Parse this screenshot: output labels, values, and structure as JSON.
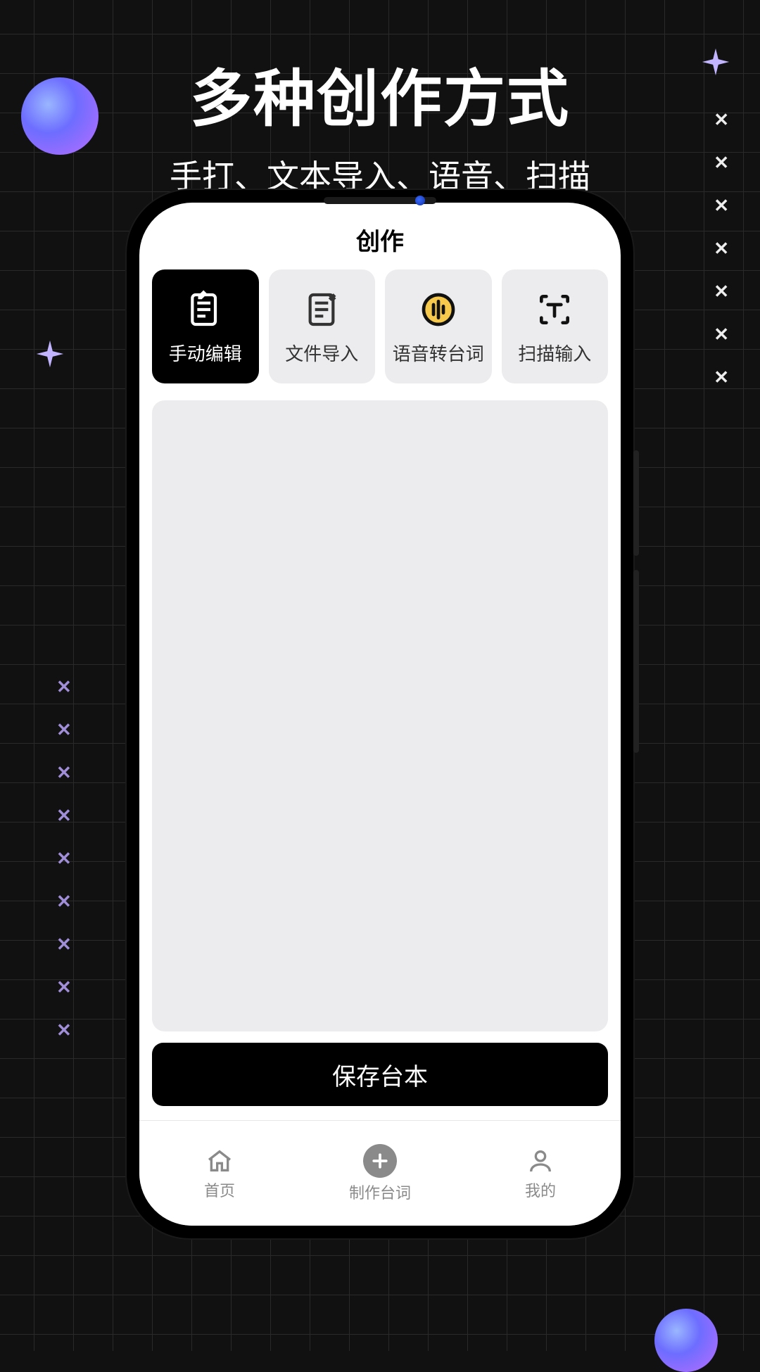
{
  "hero": {
    "title": "多种创作方式",
    "subtitle": "手打、文本导入、语音、扫描"
  },
  "app": {
    "title": "创作",
    "save_label": "保存台本"
  },
  "modes": [
    {
      "label": "手动编辑",
      "icon": "edit-note-icon",
      "active": true
    },
    {
      "label": "文件导入",
      "icon": "file-import-icon",
      "active": false
    },
    {
      "label": "语音转台词",
      "icon": "voice-icon",
      "active": false
    },
    {
      "label": "扫描输入",
      "icon": "scan-text-icon",
      "active": false
    }
  ],
  "nav": [
    {
      "label": "首页",
      "icon": "home-icon"
    },
    {
      "label": "制作台词",
      "icon": "plus-icon"
    },
    {
      "label": "我的",
      "icon": "person-icon"
    }
  ]
}
